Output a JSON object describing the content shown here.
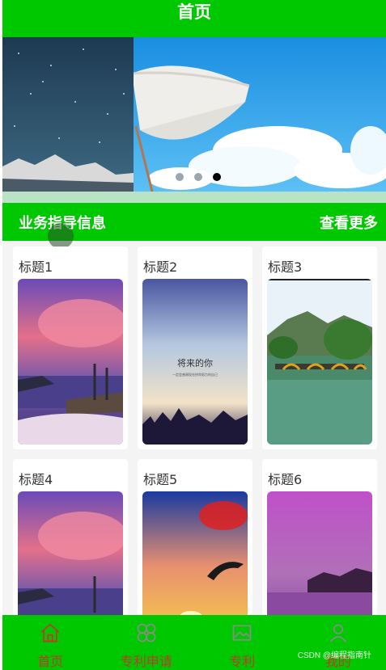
{
  "header": {
    "title": "首页"
  },
  "banner": {
    "slide_count": 3,
    "active_slide": 3
  },
  "section": {
    "title": "业务指导信息",
    "more_label": "查看更多"
  },
  "cards": [
    {
      "title": "标题1",
      "image": "pink-sunset-lake"
    },
    {
      "title": "标题2",
      "image": "future-you-poster",
      "poster_title": "将来的你",
      "poster_text_1": "一定会感谢现在拼命努力的自己",
      "poster_text_2": ""
    },
    {
      "title": "标题3",
      "image": "bridge-over-river"
    },
    {
      "title": "标题4",
      "image": "pink-sunset-lake"
    },
    {
      "title": "标题5",
      "image": "dolphin-sunset"
    },
    {
      "title": "标题6",
      "image": "purple-sea-rocks"
    }
  ],
  "tabbar": {
    "items": [
      {
        "label": "首页",
        "icon": "home-icon"
      },
      {
        "label": "专利申请",
        "icon": "grid-clover-icon"
      },
      {
        "label": "专利",
        "icon": "image-frame-icon"
      },
      {
        "label": "我的",
        "icon": "user-icon"
      }
    ]
  },
  "watermark": "CSDN @编程指南针",
  "colors": {
    "primary": "#00c800",
    "tab_label": "#c0392b"
  }
}
